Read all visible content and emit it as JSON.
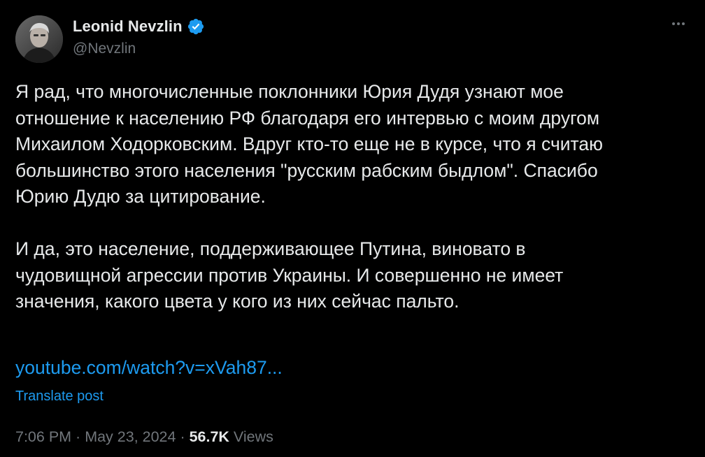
{
  "author": {
    "display_name": "Leonid Nevzlin",
    "handle": "@Nevzlin",
    "verified": true,
    "verified_color": "#1d9bf0"
  },
  "tweet": {
    "paragraph1_lines": [
      "Я рад, что многочисленные поклонники Юрия Дудя узнают мое",
      "отношение к населению РФ благодаря его интервью с моим другом",
      "Михаилом Ходорковским. Вдруг кто-то еще не в курсе, что я считаю",
      "большинство этого населения \"русским рабским быдлом\". Спасибо",
      "Юрию Дудю за цитирование."
    ],
    "paragraph2_lines": [
      "И да, это население, поддерживающее Путина, виновато в",
      "чудовищной агрессии против Украины. И совершенно не имеет",
      "значения, какого цвета у кого из них сейчас пальто."
    ],
    "link_text": "youtube.com/watch?v=xVah87...",
    "translate_label": "Translate post"
  },
  "meta": {
    "time": "7:06 PM",
    "separator1": " · ",
    "date": "May 23, 2024",
    "separator2": " · ",
    "views_count": "56.7K",
    "views_label": " Views"
  },
  "colors": {
    "background": "#000000",
    "text_primary": "#e7e9ea",
    "text_secondary": "#71767b",
    "accent": "#1d9bf0"
  }
}
